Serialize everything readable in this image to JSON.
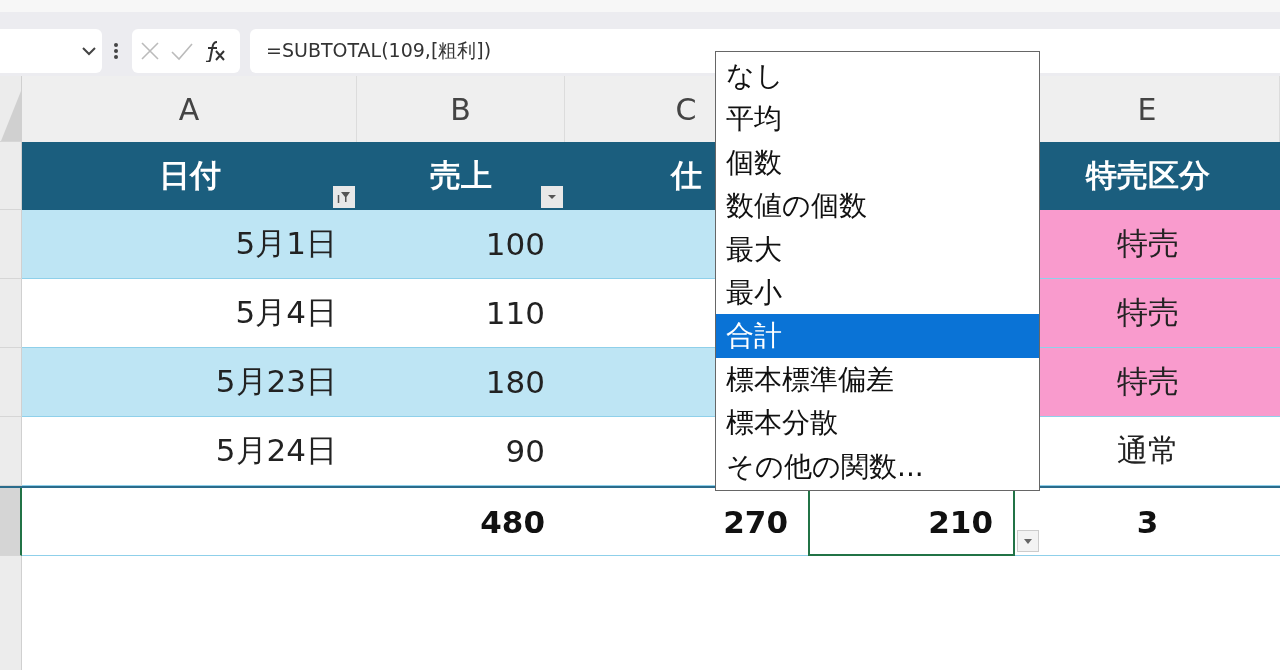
{
  "formula_bar": {
    "formula": "=SUBTOTAL(109,[粗利])"
  },
  "table": {
    "columns": [
      {
        "letter": "A",
        "header": "日付",
        "filter_button": {
          "kind": "filtered"
        }
      },
      {
        "letter": "B",
        "header": "売上",
        "filter_button": {
          "kind": "dropdown"
        }
      },
      {
        "letter": "C",
        "header": "仕"
      },
      {},
      {
        "letter": "E",
        "header": "特売区分"
      }
    ],
    "rows": [
      {
        "banded": true,
        "cells": [
          "5月1日",
          "100",
          null,
          null,
          "特売"
        ],
        "special": true
      },
      {
        "banded": false,
        "cells": [
          "5月4日",
          "110",
          null,
          null,
          "特売"
        ],
        "special": true
      },
      {
        "banded": true,
        "cells": [
          "5月23日",
          "180",
          null,
          null,
          "特売"
        ],
        "special": true
      },
      {
        "banded": false,
        "cells": [
          "5月24日",
          "90",
          null,
          null,
          "通常"
        ],
        "special": false
      }
    ],
    "total_row": [
      {
        "selected": false
      },
      {
        "text": "480",
        "selected": false
      },
      {
        "text": "270",
        "selected": false
      },
      {
        "text": "210",
        "selected": true
      },
      {
        "text": "3",
        "selected": false
      }
    ]
  },
  "total_menu": [
    {
      "label": "なし",
      "selected": false
    },
    {
      "label": "平均",
      "selected": false
    },
    {
      "label": "個数",
      "selected": false
    },
    {
      "label": "数値の個数",
      "selected": false
    },
    {
      "label": "最大",
      "selected": false
    },
    {
      "label": "最小",
      "selected": false
    },
    {
      "label": "合計",
      "selected": true
    },
    {
      "label": "標本標準偏差",
      "selected": false
    },
    {
      "label": "標本分散",
      "selected": false
    },
    {
      "label": "その他の関数...",
      "selected": false
    }
  ]
}
